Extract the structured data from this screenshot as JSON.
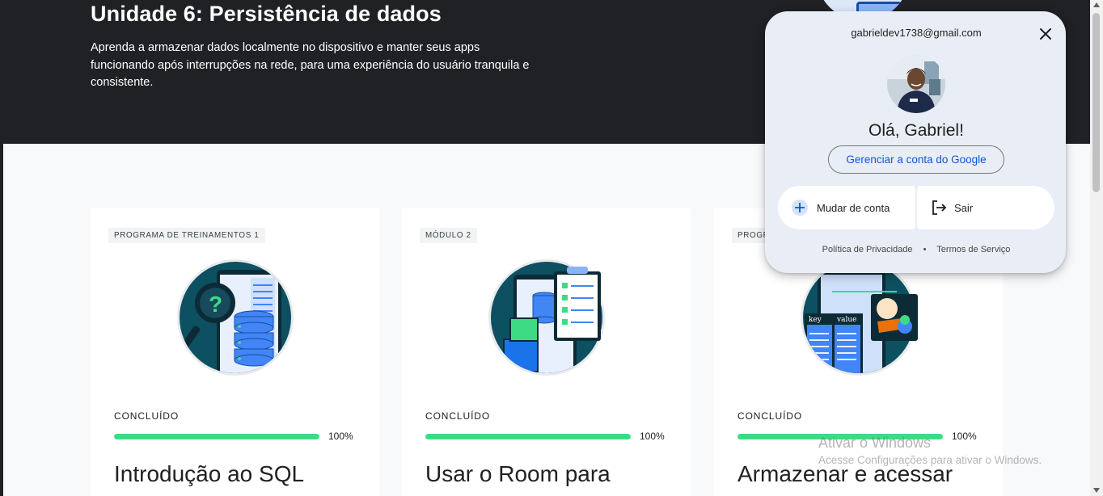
{
  "hero": {
    "title": "Unidade 6: Persistência de dados",
    "description": "Aprenda a armazenar dados localmente no dispositivo e manter seus apps funcionando após interrupções na rede, para uma experiência do usuário tranquila e consistente."
  },
  "cards": [
    {
      "tag": "PROGRAMA DE TREINAMENTOS 1",
      "illustration": "sql-database-illustration",
      "status": "CONCLUÍDO",
      "progress": 100,
      "percent_label": "100%",
      "title": "Introdução ao SQL"
    },
    {
      "tag": "MÓDULO 2",
      "illustration": "room-checklist-illustration",
      "status": "CONCLUÍDO",
      "progress": 100,
      "percent_label": "100%",
      "title": "Usar o Room para"
    },
    {
      "tag": "PROGR",
      "illustration": "key-value-datastore-illustration",
      "status": "CONCLUÍDO",
      "progress": 100,
      "percent_label": "100%",
      "title": "Armazenar e acessar",
      "key_label": "key",
      "value_label": "value"
    }
  ],
  "account_popup": {
    "email": "gabrieldev1738@gmail.com",
    "greeting": "Olá, Gabriel!",
    "manage_label": "Gerenciar a conta do Google",
    "switch_label": "Mudar de conta",
    "logout_label": "Sair",
    "privacy_label": "Política de Privacidade",
    "separator": "•",
    "terms_label": "Termos de Serviço"
  },
  "watermark": {
    "title": "Ativar o Windows",
    "subtitle": "Acesse Configurações para ativar o Windows."
  },
  "colors": {
    "hero_bg": "#202124",
    "progress": "#3ddc84",
    "link_blue": "#0b57d0",
    "popup_bg": "#e9eef6"
  }
}
